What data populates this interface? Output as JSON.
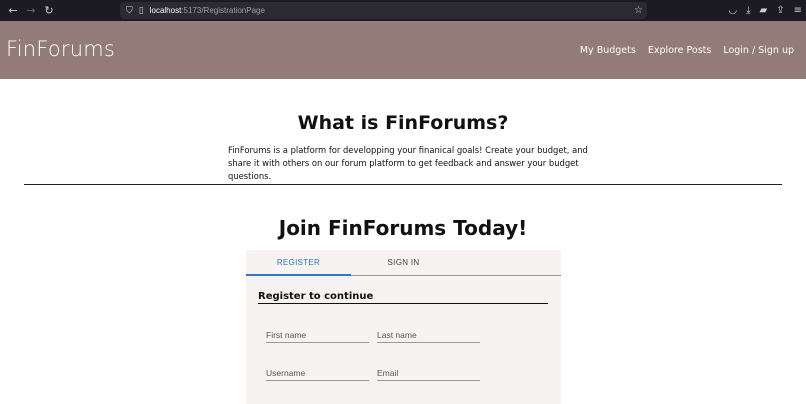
{
  "browser": {
    "url_host": "localhost",
    "url_path": ":5173/RegistrationPage",
    "icons": [
      "back-icon",
      "forward-icon",
      "reload-icon",
      "shield-icon",
      "page-icon",
      "star-icon",
      "pocket-icon",
      "download-icon",
      "extension-icon",
      "share-icon",
      "menu-icon"
    ]
  },
  "header": {
    "brand": "FinForums",
    "nav": [
      "My Budgets",
      "Explore Posts",
      "Login / Sign up"
    ],
    "background": "#927b79"
  },
  "about": {
    "title": "What is FinForums?",
    "line1": "FinForums is a platform for developping your finanical goals! Create your budget, and",
    "line2": "share it with others on our forum platform to get feedback and answer your budget questions."
  },
  "join": {
    "title": "Join FinForums Today!",
    "tabs": [
      "REGISTER",
      "SIGN IN"
    ],
    "active_tab": "REGISTER",
    "accent": "#2c79c5",
    "form_title": "Register to continue",
    "fields": {
      "first_name": "First name",
      "last_name": "Last name",
      "username": "Username",
      "email": "Email"
    }
  }
}
